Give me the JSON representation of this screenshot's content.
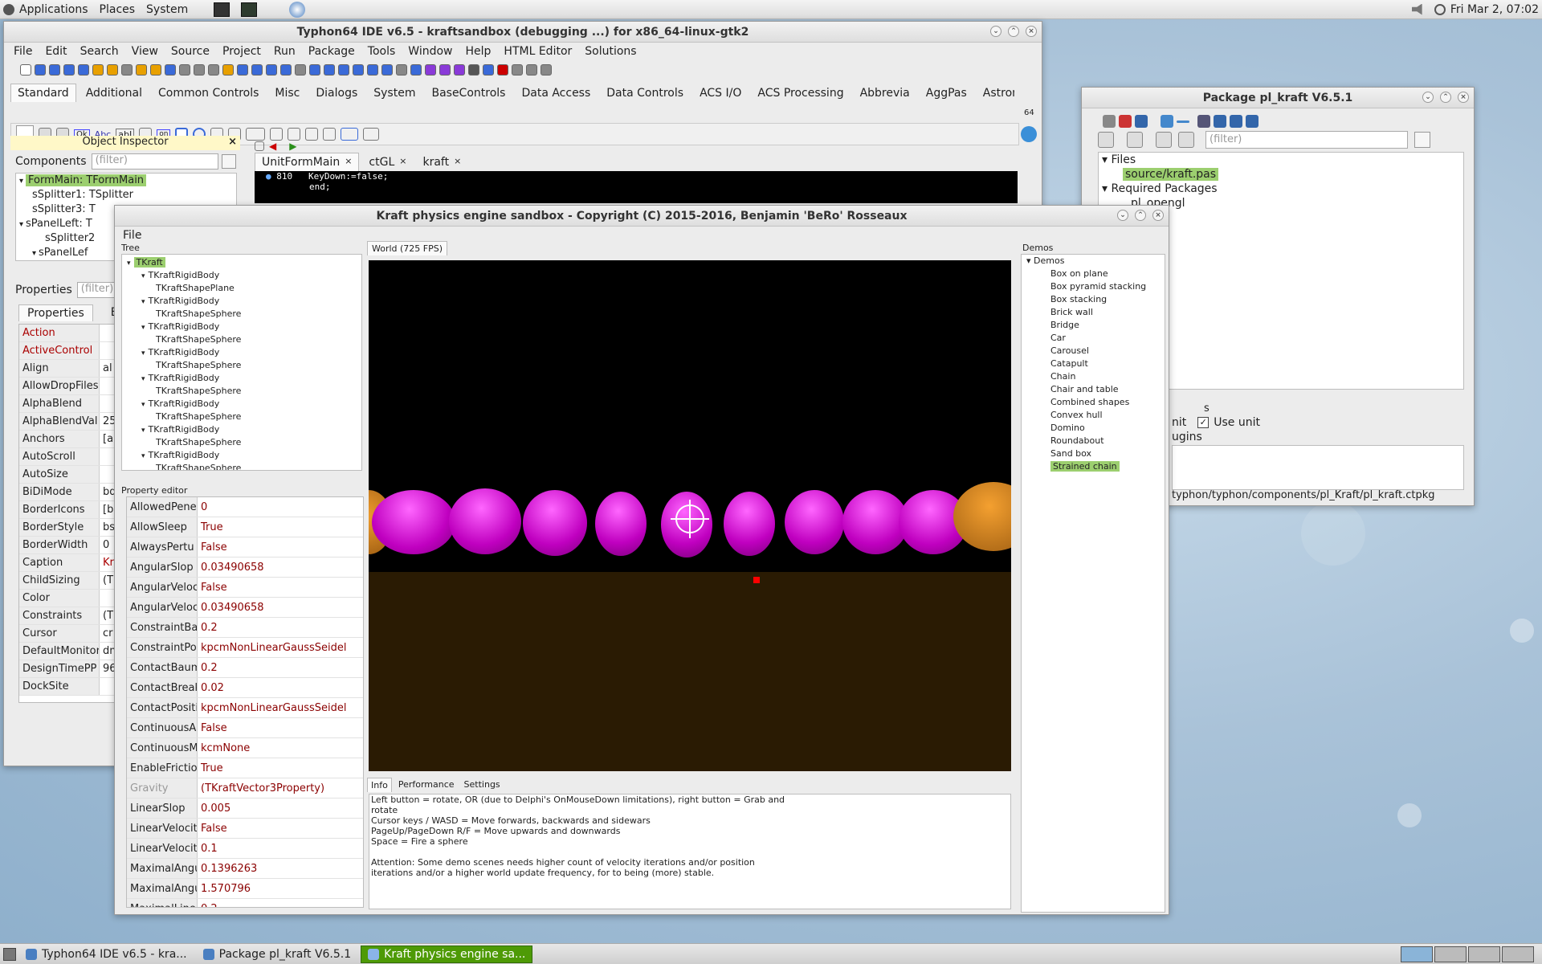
{
  "topbar": {
    "apps": "Applications",
    "places": "Places",
    "system": "System",
    "clock": "Fri Mar  2, 07:02"
  },
  "ide": {
    "title": "Typhon64 IDE v6.5 - kraftsandbox (debugging ...) for x86_64-linux-gtk2",
    "menu": [
      "File",
      "Edit",
      "Search",
      "View",
      "Source",
      "Project",
      "Run",
      "Package",
      "Tools",
      "Window",
      "Help",
      "HTML Editor",
      "Solutions"
    ],
    "palette_tabs": [
      "Standard",
      "Additional",
      "Common Controls",
      "Misc",
      "Dialogs",
      "System",
      "BaseControls",
      "Data Access",
      "Data Controls",
      "ACS I/O",
      "ACS Processing",
      "Abbrevia",
      "AggPas",
      "Astronomy"
    ],
    "palette_num": "64",
    "palette_ok": "Ok",
    "palette_abc": "Abc",
    "palette_abi": "abI",
    "palette_on": "on"
  },
  "inspector": {
    "title": "Object Inspector",
    "components": "Components",
    "filter": "(filter)",
    "tree": [
      "FormMain: TFormMain",
      "sSplitter1: TSplitter",
      "sSplitter3: T",
      "sPanelLeft: T",
      "sSplitter2",
      "sPanelLef"
    ],
    "properties_label": "Properties",
    "tabs": [
      "Properties",
      "E"
    ],
    "props": [
      [
        "Action",
        ""
      ],
      [
        "ActiveControl",
        ""
      ],
      [
        "Align",
        "al"
      ],
      [
        "AllowDropFiles",
        ""
      ],
      [
        "AlphaBlend",
        ""
      ],
      [
        "AlphaBlendVal",
        "25"
      ],
      [
        "Anchors",
        "[a"
      ],
      [
        "AutoScroll",
        ""
      ],
      [
        "AutoSize",
        ""
      ],
      [
        "BiDiMode",
        "bd"
      ],
      [
        "BorderIcons",
        "[bi"
      ],
      [
        "BorderStyle",
        "bs"
      ],
      [
        "BorderWidth",
        "0"
      ],
      [
        "Caption",
        "Kr"
      ],
      [
        "ChildSizing",
        "(T"
      ],
      [
        "Color",
        ""
      ],
      [
        "Constraints",
        "(T"
      ],
      [
        "Cursor",
        "cr"
      ],
      [
        "DefaultMonitor",
        "dm"
      ],
      [
        "DesignTimePP",
        "96"
      ],
      [
        "DockSite",
        ""
      ]
    ]
  },
  "editor": {
    "tabs": [
      "UnitFormMain",
      "ctGL",
      "kraft"
    ],
    "line_no": "810",
    "code": [
      "  KeyDown:=false;",
      "end;"
    ]
  },
  "package": {
    "title": "Package pl_kraft V6.5.1",
    "filter": "(filter)",
    "files": "Files",
    "file1": "source/kraft.pas",
    "required": "Required Packages",
    "req1": "pl_opengl",
    "use_unit": "Use unit",
    "nit": "nit",
    "s": "s",
    "ugins": "ugins",
    "path": "typhon/typhon/components/pl_Kraft/pl_kraft.ctpkg"
  },
  "kraft": {
    "title": "Kraft physics engine sandbox - Copyright (C) 2015-2016, Benjamin 'BeRo' Rosseaux",
    "menu": "File",
    "tree_label": "Tree",
    "world_tab": "World (725 FPS)",
    "tree": [
      [
        "TKraft",
        0
      ],
      [
        "TKraftRigidBody",
        1
      ],
      [
        "TKraftShapePlane",
        2
      ],
      [
        "TKraftRigidBody",
        1
      ],
      [
        "TKraftShapeSphere",
        2
      ],
      [
        "TKraftRigidBody",
        1
      ],
      [
        "TKraftShapeSphere",
        2
      ],
      [
        "TKraftRigidBody",
        1
      ],
      [
        "TKraftShapeSphere",
        2
      ],
      [
        "TKraftRigidBody",
        1
      ],
      [
        "TKraftShapeSphere",
        2
      ],
      [
        "TKraftRigidBody",
        1
      ],
      [
        "TKraftShapeSphere",
        2
      ],
      [
        "TKraftRigidBody",
        1
      ],
      [
        "TKraftShapeSphere",
        2
      ],
      [
        "TKraftRigidBody",
        1
      ],
      [
        "TKraftShapeSphere",
        2
      ]
    ],
    "prop_editor": "Property editor",
    "props": [
      [
        "AllowedPene",
        "0"
      ],
      [
        "AllowSleep",
        "True"
      ],
      [
        "AlwaysPertu",
        "False"
      ],
      [
        "AngularSlop",
        "0.03490658"
      ],
      [
        "AngularVeloc",
        "False"
      ],
      [
        "AngularVeloc",
        "0.03490658"
      ],
      [
        "ConstraintBa",
        "0.2"
      ],
      [
        "ConstraintPo",
        "kpcmNonLinearGaussSeidel"
      ],
      [
        "ContactBaum",
        "0.2"
      ],
      [
        "ContactBreak",
        "0.02"
      ],
      [
        "ContactPositi",
        "kpcmNonLinearGaussSeidel"
      ],
      [
        "ContinuousA",
        "False"
      ],
      [
        "ContinuousM",
        "kcmNone"
      ],
      [
        "EnableFrictio",
        "True"
      ],
      [
        "Gravity",
        "(TKraftVector3Property)"
      ],
      [
        "LinearSlop",
        "0.005"
      ],
      [
        "LinearVelocit",
        "False"
      ],
      [
        "LinearVelocit",
        "0.1"
      ],
      [
        "MaximalAngu",
        "0.1396263"
      ],
      [
        "MaximalAngu",
        "1.570796"
      ],
      [
        "MaximalLine",
        "0.2"
      ]
    ],
    "info_tabs": [
      "Info",
      "Performance",
      "Settings"
    ],
    "info_lines": [
      "Left button = rotate, OR (due to Delphi's OnMouseDown limitations), right button = Grab and",
      "rotate",
      "Cursor keys / WASD = Move forwards, backwards and sidewars",
      "PageUp/PageDown R/F = Move upwards and downwards",
      "Space = Fire a sphere",
      "",
      "Attention: Some demo scenes needs higher count of velocity iterations and/or position",
      "iterations and/or a higher world update frequency, for to being (more) stable."
    ],
    "demos_label": "Demos",
    "demos_root": "Demos",
    "demos": [
      "Box on plane",
      "Box pyramid stacking",
      "Box stacking",
      "Brick wall",
      "Bridge",
      "Car",
      "Carousel",
      "Catapult",
      "Chain",
      "Chair and table",
      "Combined shapes",
      "Convex hull",
      "Domino",
      "Roundabout",
      "Sand box",
      "Strained chain"
    ]
  },
  "taskbar": [
    "Typhon64 IDE v6.5 - kra...",
    "Package pl_kraft V6.5.1",
    "Kraft physics engine sa..."
  ]
}
